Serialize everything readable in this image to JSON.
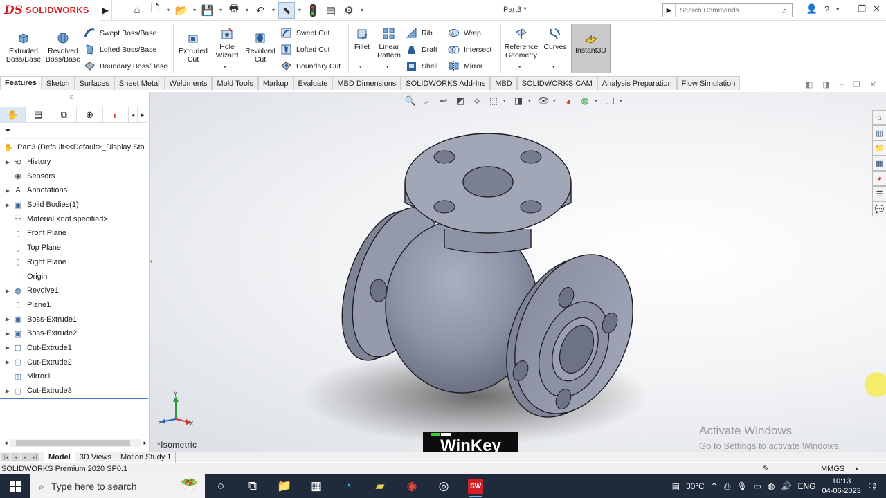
{
  "app": {
    "brand": "SOLIDWORKS",
    "document_title": "Part3 *",
    "search_placeholder": "Search Commands"
  },
  "ribbon": {
    "extruded_boss": "Extruded\nBoss/Base",
    "revolved_boss": "Revolved\nBoss/Base",
    "swept_boss": "Swept Boss/Base",
    "lofted_boss": "Lofted Boss/Base",
    "boundary_boss": "Boundary Boss/Base",
    "extruded_cut": "Extruded\nCut",
    "hole_wizard": "Hole\nWizard",
    "revolved_cut": "Revolved\nCut",
    "swept_cut": "Swept Cut",
    "lofted_cut": "Lofted Cut",
    "boundary_cut": "Boundary Cut",
    "fillet": "Fillet",
    "linear_pattern": "Linear\nPattern",
    "rib": "Rib",
    "draft": "Draft",
    "shell": "Shell",
    "wrap": "Wrap",
    "intersect": "Intersect",
    "mirror": "Mirror",
    "reference_geometry": "Reference\nGeometry",
    "curves": "Curves",
    "instant3d": "Instant3D"
  },
  "command_tabs": [
    "Features",
    "Sketch",
    "Surfaces",
    "Sheet Metal",
    "Weldments",
    "Mold Tools",
    "Markup",
    "Evaluate",
    "MBD Dimensions",
    "SOLIDWORKS Add-Ins",
    "MBD",
    "SOLIDWORKS CAM",
    "Analysis Preparation",
    "Flow Simulation"
  ],
  "tree": {
    "root": "Part3  (Default<<Default>_Display Sta",
    "items": [
      {
        "label": "History",
        "expand": true,
        "icon": "history-icon"
      },
      {
        "label": "Sensors",
        "expand": false,
        "icon": "sensor-icon"
      },
      {
        "label": "Annotations",
        "expand": true,
        "icon": "annotation-icon"
      },
      {
        "label": "Solid Bodies(1)",
        "expand": true,
        "icon": "solid-bodies-icon"
      },
      {
        "label": "Material <not specified>",
        "expand": false,
        "icon": "material-icon"
      },
      {
        "label": "Front Plane",
        "expand": false,
        "icon": "plane-icon"
      },
      {
        "label": "Top Plane",
        "expand": false,
        "icon": "plane-icon"
      },
      {
        "label": "Right Plane",
        "expand": false,
        "icon": "plane-icon"
      },
      {
        "label": "Origin",
        "expand": false,
        "icon": "origin-icon"
      },
      {
        "label": "Revolve1",
        "expand": true,
        "icon": "revolve-icon"
      },
      {
        "label": "Plane1",
        "expand": false,
        "icon": "plane-icon"
      },
      {
        "label": "Boss-Extrude1",
        "expand": true,
        "icon": "extrude-icon"
      },
      {
        "label": "Boss-Extrude2",
        "expand": true,
        "icon": "extrude-icon"
      },
      {
        "label": "Cut-Extrude1",
        "expand": true,
        "icon": "cut-extrude-icon"
      },
      {
        "label": "Cut-Extrude2",
        "expand": true,
        "icon": "cut-extrude-icon"
      },
      {
        "label": "Mirror1",
        "expand": false,
        "icon": "mirror-icon"
      },
      {
        "label": "Cut-Extrude3",
        "expand": true,
        "icon": "cut-extrude-icon"
      }
    ]
  },
  "viewport": {
    "view_label": "*Isometric",
    "watermark_line1": "Activate Windows",
    "watermark_line2": "Go to Settings to activate Windows.",
    "overlay_key": "WinKey",
    "triad_x": "X",
    "triad_y": "Y",
    "triad_z": "Z"
  },
  "bottom_tabs": [
    "Model",
    "3D Views",
    "Motion Study 1"
  ],
  "status": {
    "product": "SOLIDWORKS Premium 2020 SP0.1",
    "units": "MMGS"
  },
  "taskbar": {
    "search_placeholder": "Type here to search",
    "temperature": "30°C",
    "language": "ENG",
    "time": "10:13",
    "date": "04-06-2023",
    "notifications": "2"
  },
  "colors": {
    "brand_red": "#d32027",
    "part_gray": "#8e93a5",
    "selection_blue": "#3b82c4"
  }
}
